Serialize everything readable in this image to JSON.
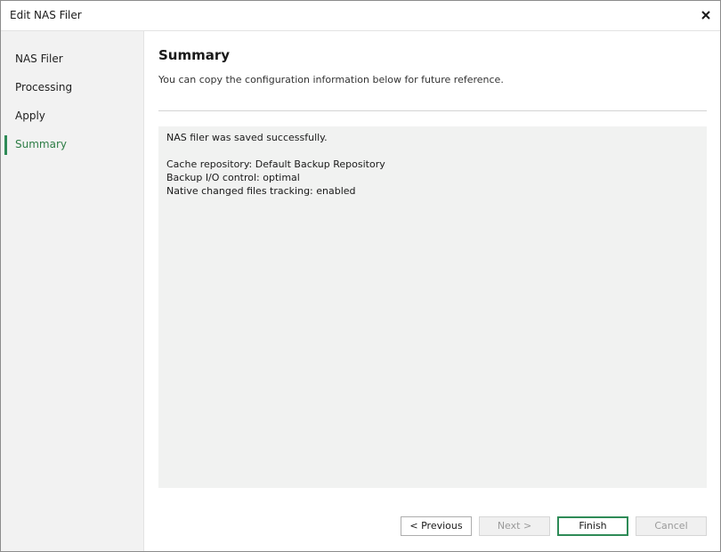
{
  "window": {
    "title": "Edit NAS Filer",
    "close_icon": "close-icon"
  },
  "sidebar": {
    "items": [
      {
        "label": "NAS Filer",
        "active": false
      },
      {
        "label": "Processing",
        "active": false
      },
      {
        "label": "Apply",
        "active": false
      },
      {
        "label": "Summary",
        "active": true
      }
    ]
  },
  "main": {
    "title": "Summary",
    "subtitle": "You can copy the configuration information below for future reference.",
    "summary_lines": [
      "NAS filer was saved successfully.",
      "Cache repository: Default Backup Repository",
      "Backup I/O control: optimal",
      "Native changed files tracking: enabled"
    ]
  },
  "buttons": {
    "previous": "< Previous",
    "next": "Next >",
    "finish": "Finish",
    "cancel": "Cancel"
  },
  "colors": {
    "accent": "#2e8b57",
    "sidebar_bg": "#f2f2f2",
    "summary_bg": "#f1f2f1"
  }
}
